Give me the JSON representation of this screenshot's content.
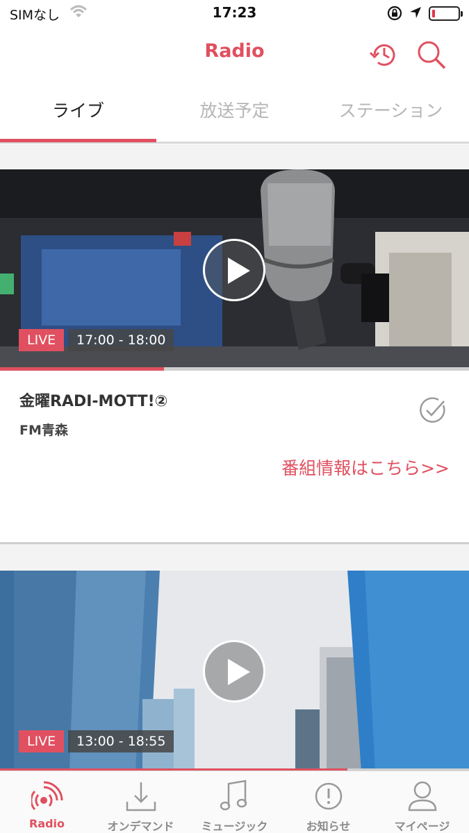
{
  "status_bar": {
    "carrier": "SIMなし",
    "time": "17:23"
  },
  "header": {
    "title": "Radio"
  },
  "tabs": [
    {
      "label": "ライブ",
      "active": true
    },
    {
      "label": "放送予定",
      "active": false
    },
    {
      "label": "ステーション",
      "active": false
    }
  ],
  "cards": [
    {
      "badge": "LIVE",
      "time_range": "17:00 - 18:00",
      "progress": 0.35,
      "title": "金曜RADI-MOTT!②",
      "station": "FM青森",
      "info_link": "番組情報はこちら>>"
    },
    {
      "badge": "LIVE",
      "time_range": "13:00 - 18:55",
      "progress": 0.74
    }
  ],
  "bottom_nav": [
    {
      "label": "Radio",
      "icon": "radio-icon",
      "active": true
    },
    {
      "label": "オンデマンド",
      "icon": "download-icon",
      "active": false
    },
    {
      "label": "ミュージック",
      "icon": "music-note-icon",
      "active": false
    },
    {
      "label": "お知らせ",
      "icon": "info-icon",
      "active": false
    },
    {
      "label": "マイページ",
      "icon": "user-icon",
      "active": false
    }
  ],
  "colors": {
    "accent": "#e0505f",
    "inactive": "#8a8a8a"
  }
}
